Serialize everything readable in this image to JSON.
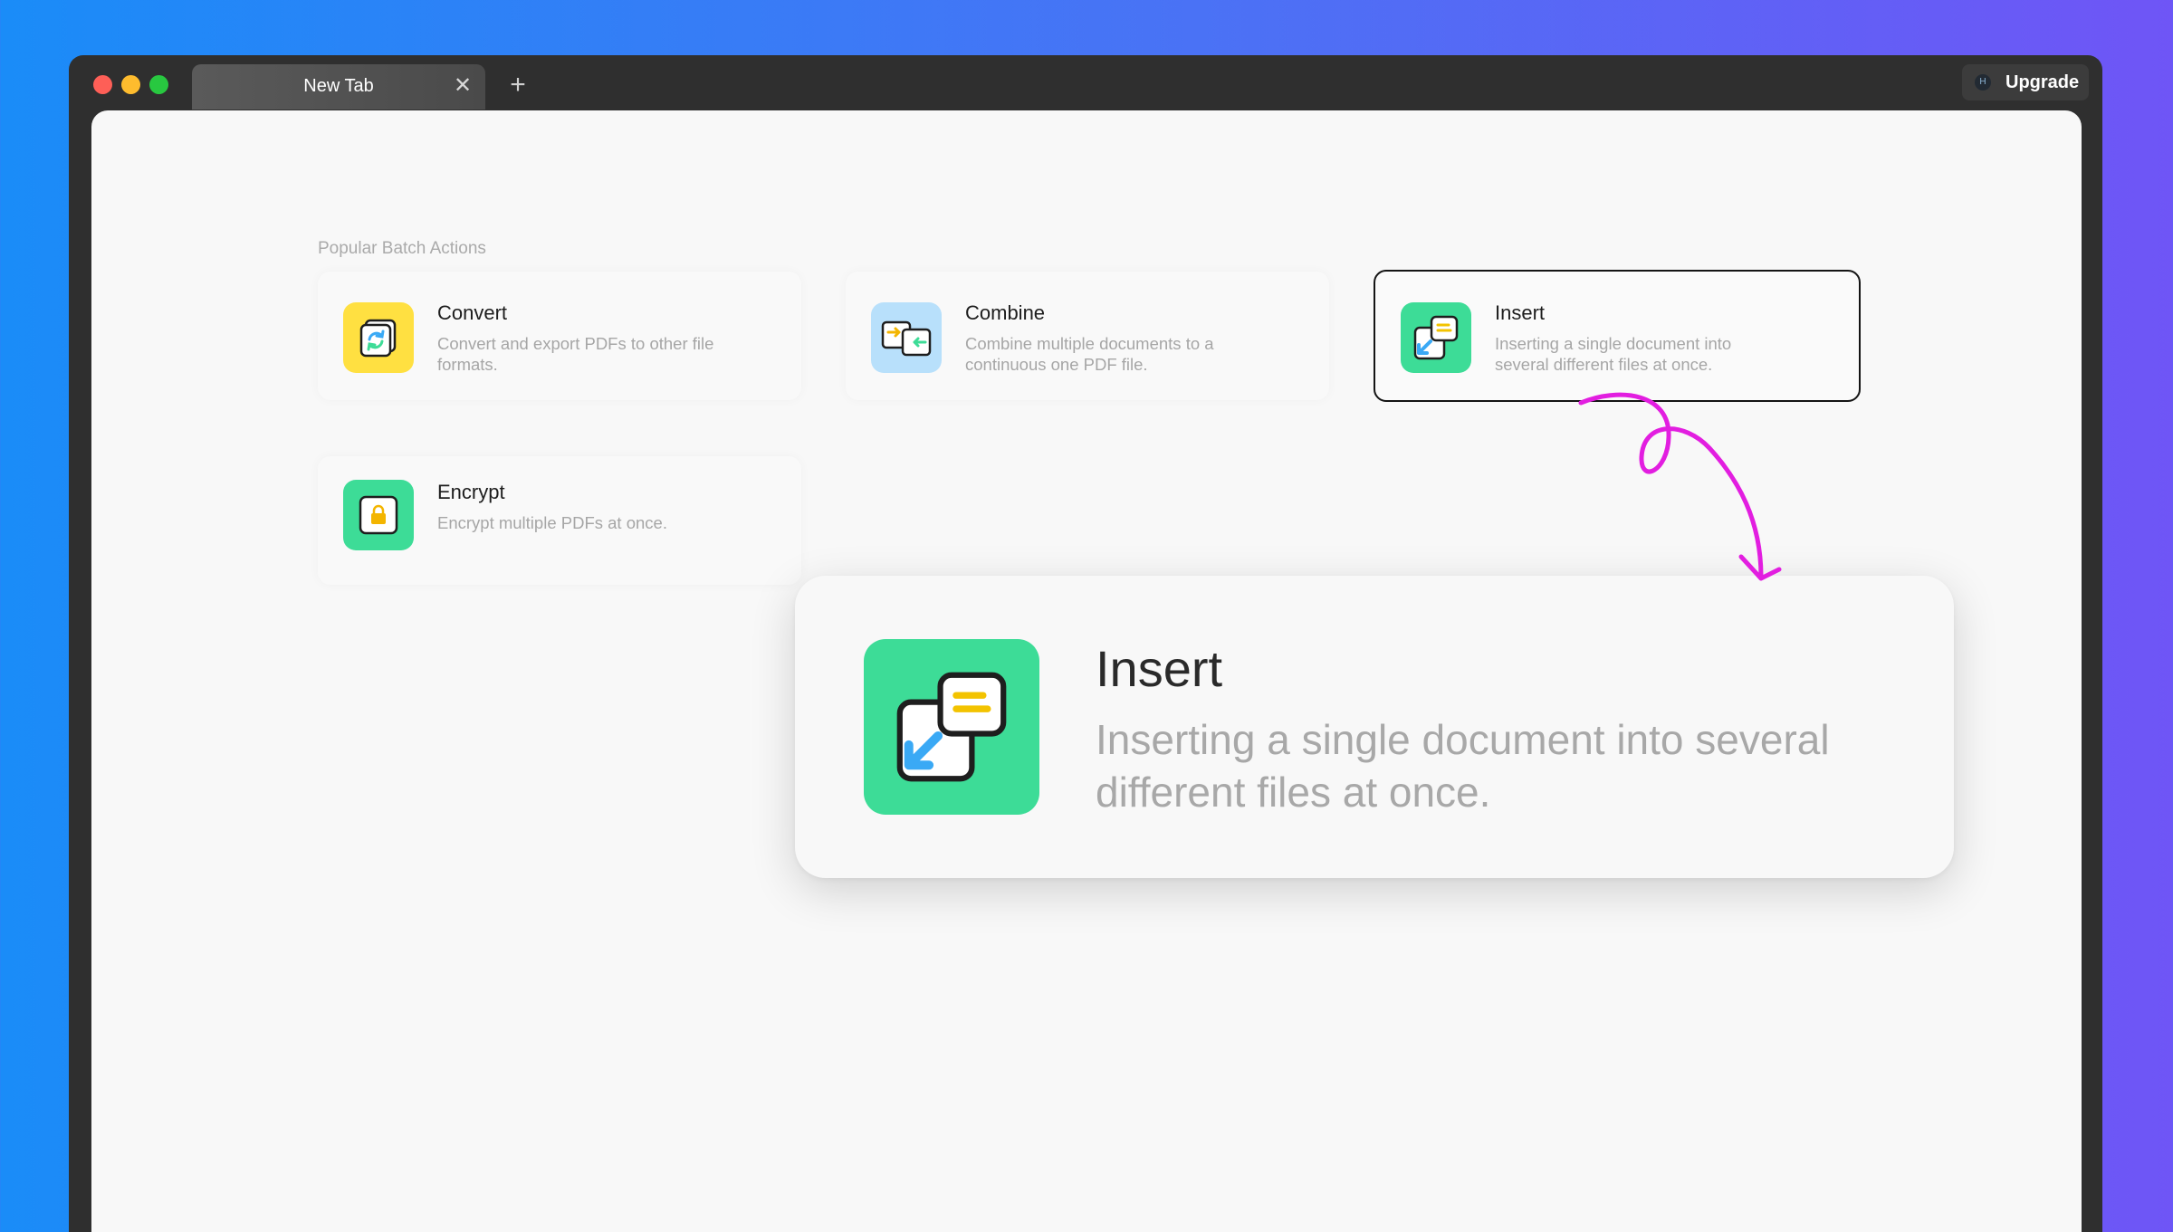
{
  "titlebar": {
    "tab_label": "New Tab",
    "tab_close_glyph": "✕",
    "new_tab_glyph": "+",
    "upgrade_label": "Upgrade",
    "upgrade_badge_glyph": "H"
  },
  "main": {
    "section_title": "Popular Batch Actions",
    "actions": [
      {
        "title": "Convert",
        "desc": "Convert and export PDFs to other file formats.",
        "icon": "convert-icon",
        "color": "#ffe041"
      },
      {
        "title": "Combine",
        "desc": "Combine multiple documents to a continuous one PDF file.",
        "icon": "combine-icon",
        "color": "#b8e0fb"
      },
      {
        "title": "Insert",
        "desc": "Inserting a single document into several different files at once.",
        "icon": "insert-icon",
        "color": "#3ddc97",
        "selected": true
      },
      {
        "title": "Encrypt",
        "desc": "Encrypt multiple PDFs at once.",
        "icon": "encrypt-icon",
        "color": "#3ddc97"
      }
    ]
  },
  "callout": {
    "title": "Insert",
    "desc": "Inserting a single document into several different files at once.",
    "icon": "insert-icon",
    "arrow_color": "#e21ee0"
  },
  "colors": {
    "background_start": "#1a8cf8",
    "background_end": "#6f55f6",
    "window_chrome": "#2f2f2f",
    "content_bg": "#f8f8f8"
  }
}
